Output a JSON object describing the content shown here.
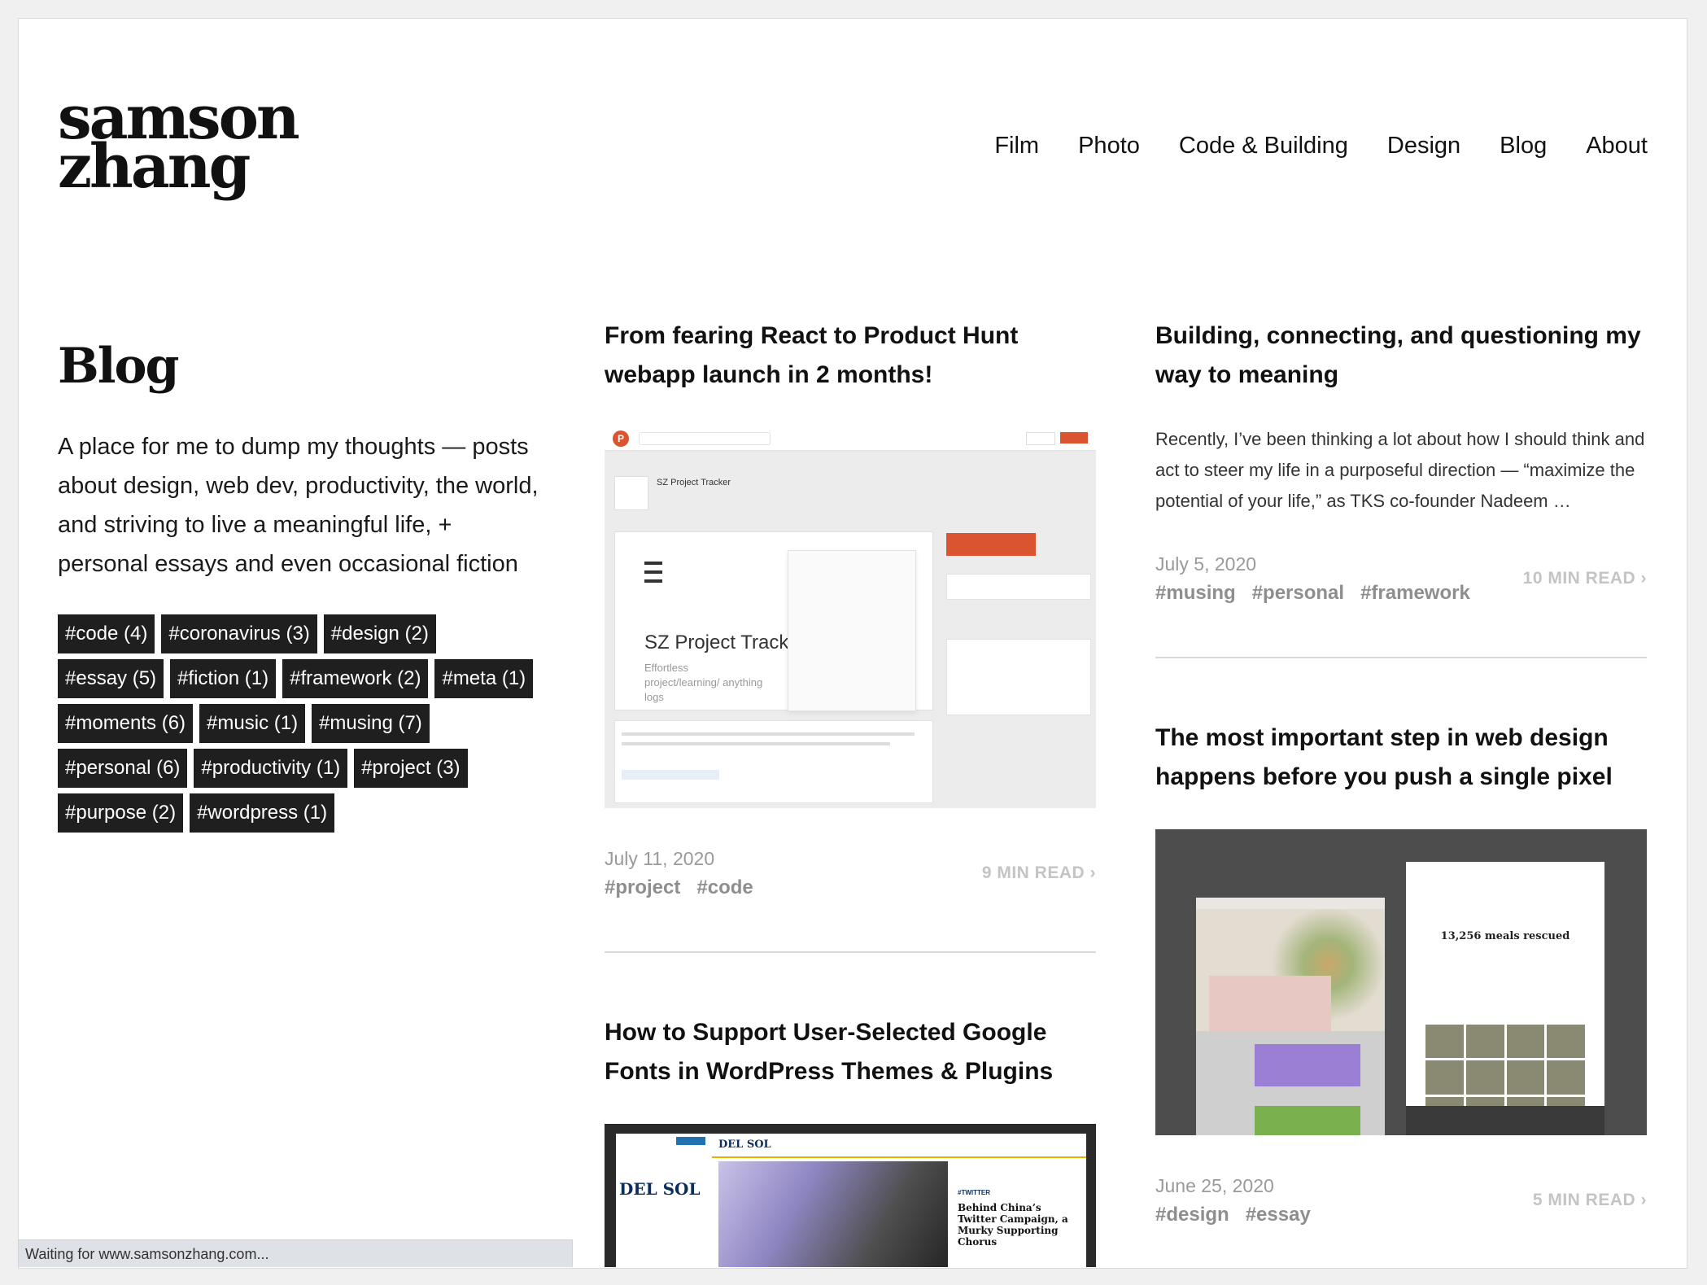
{
  "brand": {
    "line1": "samson",
    "line2": "zhang"
  },
  "nav": {
    "items": [
      "Film",
      "Photo",
      "Code & Building",
      "Design",
      "Blog",
      "About"
    ]
  },
  "sidebar": {
    "title": "Blog",
    "intro": "A place for me to dump my thoughts — posts about design, web dev, productivity, the world, and striving to live a meaningful life, + personal essays and even occasional fiction",
    "tags": [
      "#code (4)",
      "#coronavirus (3)",
      "#design (2)",
      "#essay (5)",
      "#fiction (1)",
      "#framework (2)",
      "#meta (1)",
      "#moments (6)",
      "#music (1)",
      "#musing (7)",
      "#personal (6)",
      "#productivity (1)",
      "#project (3)",
      "#purpose (2)",
      "#wordpress (1)"
    ]
  },
  "posts": {
    "p1": {
      "title": "From fearing React to Product Hunt webapp launch in 2 months!",
      "date": "July 11, 2020",
      "tags": [
        "#project",
        "#code"
      ],
      "read": "9 MIN READ ›",
      "thumb": {
        "app_title": "SZ Project Tracker",
        "app_sub": "Effortless project/learning/ anything logs",
        "logo_letter": "P"
      }
    },
    "p2": {
      "title": "Building, connecting, and questioning my way to meaning",
      "excerpt": "Recently, I’ve been thinking a lot about how I should think and act to steer my life in a purposeful direction — “maximize the potential of your life,” as TKS co-founder Nadeem …",
      "date": "July 5, 2020",
      "tags": [
        "#musing",
        "#personal",
        "#framework"
      ],
      "read": "10 MIN READ ›"
    },
    "p3": {
      "title": "The most important step in web design happens before you push a single pixel",
      "date": "June 25, 2020",
      "tags": [
        "#design",
        "#essay"
      ],
      "read": "5 MIN READ ›",
      "thumb": {
        "headline": "13,256 meals rescued"
      }
    },
    "p4": {
      "title": "How to Support User-Selected Google Fonts in WordPress Themes & Plugins",
      "thumb": {
        "brand": "DEL SOL",
        "panel_brand": "DEL SOL",
        "tag": "#TWITTER",
        "headline": "Behind China’s Twitter Campaign, a Murky Supporting Chorus"
      }
    }
  },
  "status_bar": {
    "text": "Waiting for www.samsonzhang.com..."
  }
}
